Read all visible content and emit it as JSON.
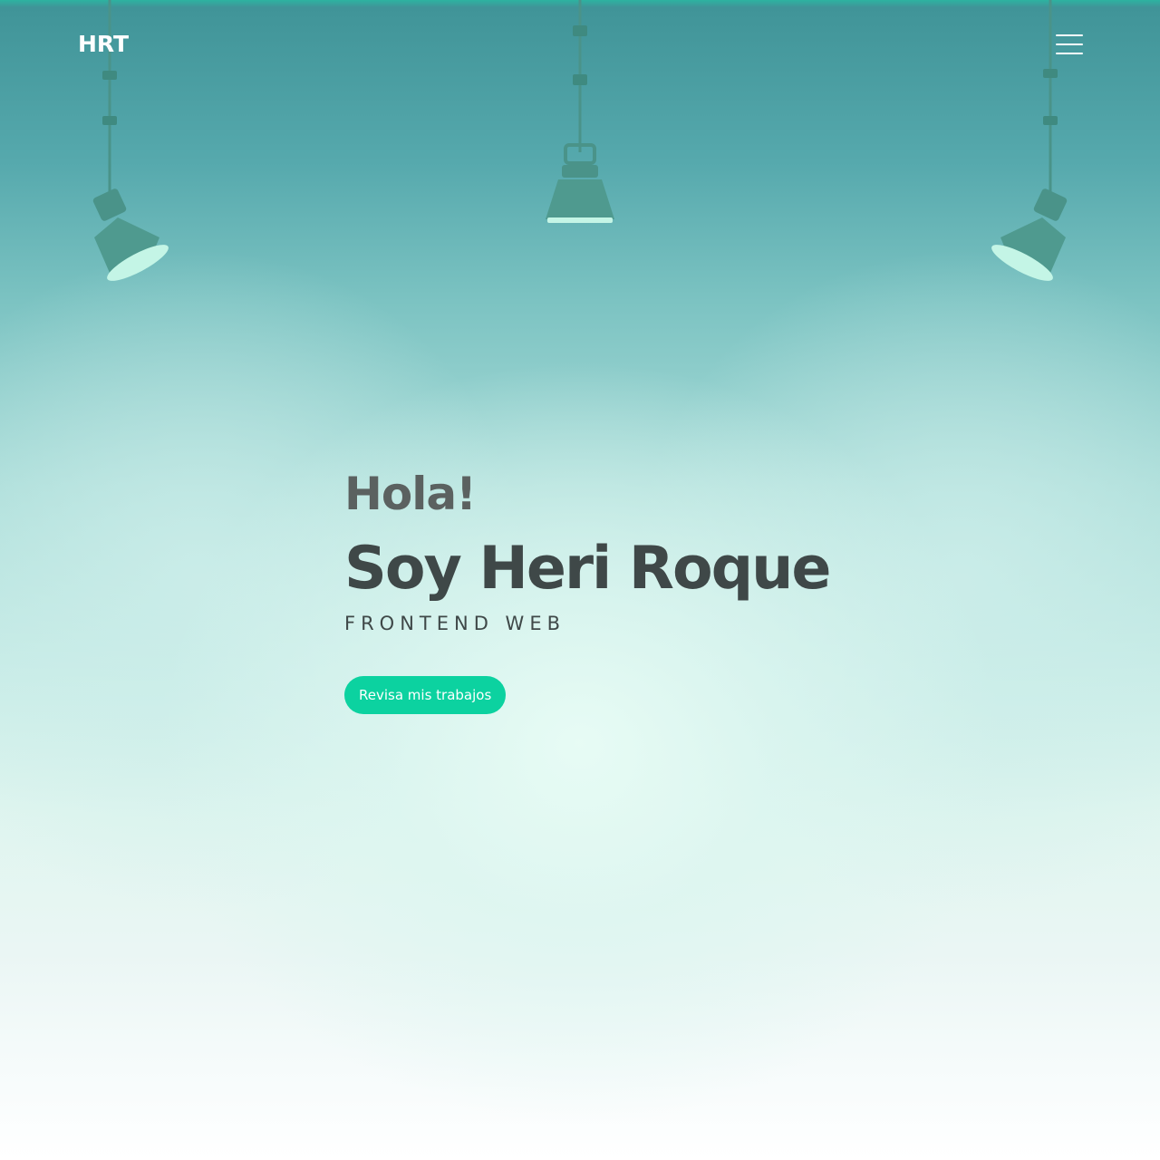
{
  "header": {
    "logo": "HRT",
    "menu_icon": "hamburger-menu-icon"
  },
  "hero": {
    "greeting": "Hola!",
    "name": "Soy Heri Roque",
    "role": "FRONTEND WEB",
    "cta_label": "Revisa mis trabajos"
  },
  "colors": {
    "accent": "#0cd2a0",
    "heading": "#3f4848",
    "greeting": "#5b6160",
    "lamp": "#4a9389"
  }
}
